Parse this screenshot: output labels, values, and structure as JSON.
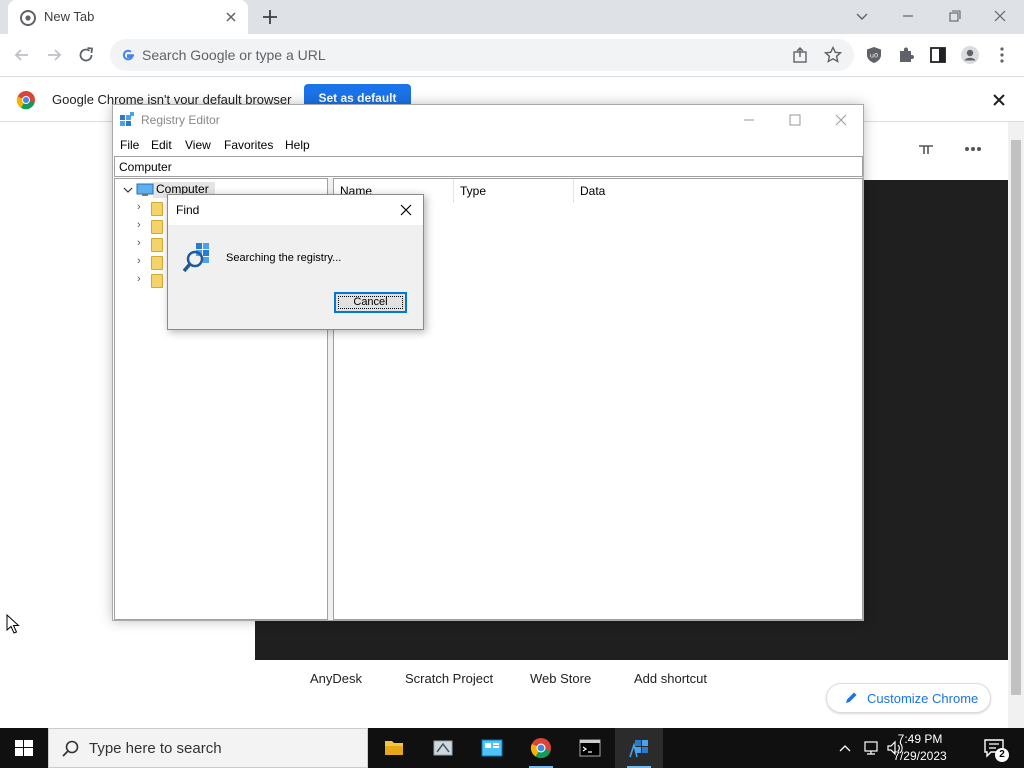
{
  "browser": {
    "tab_title": "New Tab",
    "omnibox_placeholder": "Search Google or type a URL",
    "infobar_message": "Google Chrome isn't your default browser",
    "infobar_button": "Set as default"
  },
  "ntp": {
    "shortcuts": [
      "AnyDesk",
      "Scratch Project",
      "Web Store",
      "Add shortcut"
    ],
    "customize_label": "Customize Chrome"
  },
  "regedit": {
    "title": "Registry Editor",
    "menu": [
      "File",
      "Edit",
      "View",
      "Favorites",
      "Help"
    ],
    "address": "Computer",
    "tree_root": "Computer",
    "columns": [
      "Name",
      "Type",
      "Data"
    ]
  },
  "find_dialog": {
    "title": "Find",
    "message": "Searching the registry...",
    "cancel_label": "Cancel"
  },
  "taskbar": {
    "search_placeholder": "Type here to search",
    "time": "7:49 PM",
    "date": "7/29/2023",
    "notification_count": "2"
  },
  "colors": {
    "chrome_blue": "#1a73e8",
    "taskbar_bg": "#101010",
    "tabstrip_bg": "#dee1e6"
  }
}
